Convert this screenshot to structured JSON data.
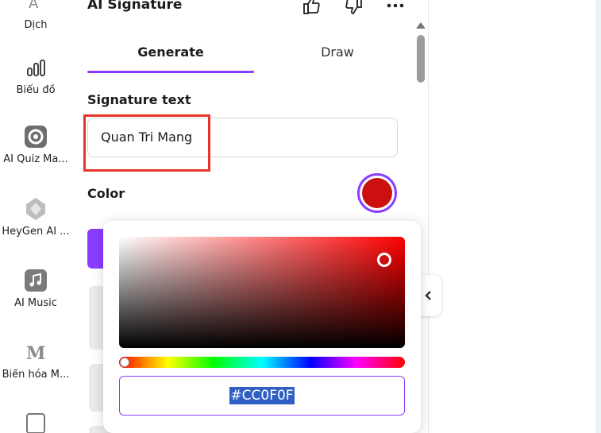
{
  "rail": {
    "items": [
      {
        "label": "Dịch",
        "icon": "translate-icon"
      },
      {
        "label": "Biểu đồ",
        "icon": "chart-icon"
      },
      {
        "label": "AI Quiz Ma...",
        "icon": "ai-quiz-app-icon"
      },
      {
        "label": "HeyGen AI ...",
        "icon": "heygen-app-icon"
      },
      {
        "label": "AI Music",
        "icon": "music-note-icon"
      },
      {
        "label": "Biến hóa M...",
        "icon": "transform-app-icon"
      }
    ]
  },
  "panel": {
    "title": "AI Signature",
    "tabs": [
      {
        "label": "Generate",
        "active": true
      },
      {
        "label": "Draw",
        "active": false
      }
    ],
    "signature_label": "Signature text",
    "signature_value": "Quan Tri Mang",
    "color_label": "Color",
    "color_value": "#CC0F0F"
  },
  "picker": {
    "hex_value": "#CC0F0F",
    "hue_fraction": 0
  },
  "colors": {
    "accent": "#8b3dff",
    "highlight": "#e8352b",
    "selected_color": "#cc0f0f"
  }
}
